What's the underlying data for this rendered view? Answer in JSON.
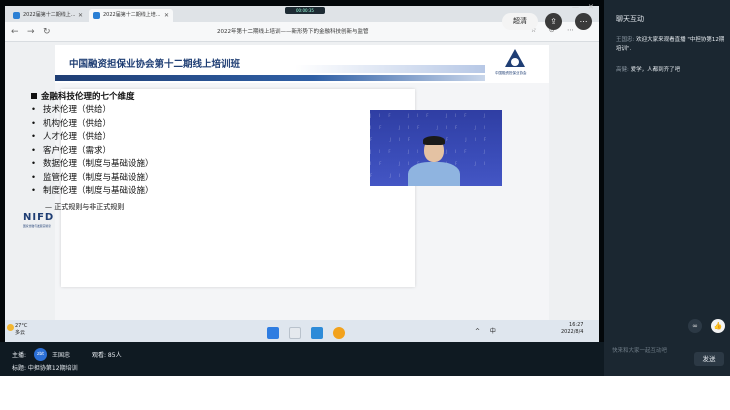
{
  "browser": {
    "tabs": [
      {
        "label": "2022届第十二期线上..."
      },
      {
        "label": "2022届第十二期线上培..."
      }
    ],
    "minibar": "00:00:35",
    "page_title": "2022年第十二期线上培训——新形势下的金融科技创新与监管"
  },
  "slide": {
    "title": "中国融资担保业协会第十二期线上培训班",
    "logo_text": "中国融资担保业协会",
    "heading": "金融科技伦理的七个维度",
    "items": [
      "技术伦理（供给）",
      "机构伦理（供给）",
      "人才伦理（供给）",
      "客户伦理（需求）",
      "数据伦理（制度与基础设施）",
      "监管伦理（制度与基础设施）",
      "制度伦理（制度与基础设施）"
    ],
    "subitem": "— 正式规则与非正式规则",
    "nifd": "NIFD",
    "nifd_sub": "国家金融与发展实验室"
  },
  "presenter": {
    "pattern": "JIF JIF JIF JIF JIF JIF JIF JIF JIF JIF JIF JIF JIF JIF JIF JIF JIF JIF"
  },
  "player": {
    "quality": "超清",
    "window_controls": [
      "—",
      "✕"
    ]
  },
  "taskbar": {
    "temp": "27°C",
    "weather": "多云",
    "tray": "^ 中 ",
    "time": "16:27",
    "date": "2022/8/4"
  },
  "chat": {
    "title": "聊天互动",
    "messages": [
      {
        "who": "王国忠:",
        "text": " 欢迎大家来观看直播 \"中担协第12期培训\"."
      },
      {
        "who": "高健:",
        "text": " 爱学，人都到齐了吧"
      }
    ],
    "input_placeholder": "快来和大家一起互动吧",
    "send": "发送"
  },
  "info": {
    "host_label": "主播:",
    "avatar": "zbt",
    "host_name": "王国忠",
    "heat": "观看: 85人",
    "topic": "标题: 中担协第12期培训"
  }
}
